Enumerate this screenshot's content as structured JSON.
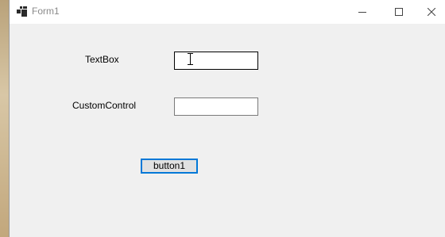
{
  "window": {
    "title": "Form1"
  },
  "form": {
    "textbox_label": "TextBox",
    "textbox_value": "",
    "customcontrol_label": "CustomControl",
    "customcontrol_value": "",
    "button_label": "button1"
  },
  "icons": {
    "app": "form-app-icon",
    "minimize": "minimize-icon",
    "maximize": "maximize-icon",
    "close": "close-icon",
    "cursor": "text-cursor-icon"
  },
  "colors": {
    "client_bg": "#f0f0f0",
    "titlebar_bg": "#ffffff",
    "button_focus_border": "#0078d7",
    "button_bg": "#e1e1e1"
  }
}
